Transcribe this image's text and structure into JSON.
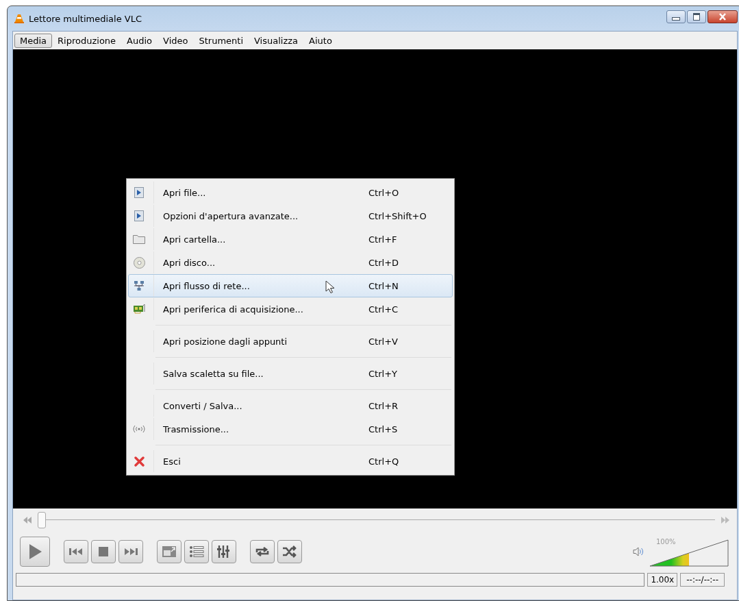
{
  "window": {
    "title": "Lettore multimediale VLC"
  },
  "menubar": [
    {
      "label": "Media",
      "selected": true
    },
    {
      "label": "Riproduzione",
      "selected": false
    },
    {
      "label": "Audio",
      "selected": false
    },
    {
      "label": "Video",
      "selected": false
    },
    {
      "label": "Strumenti",
      "selected": false
    },
    {
      "label": "Visualizza",
      "selected": false
    },
    {
      "label": "Aiuto",
      "selected": false
    }
  ],
  "menu": {
    "sections": [
      [
        {
          "kind": "file",
          "label": "Apri file...",
          "shortcut": "Ctrl+O",
          "selected": false
        },
        {
          "kind": "file",
          "label": "Opzioni d'apertura avanzate...",
          "shortcut": "Ctrl+Shift+O",
          "selected": false
        },
        {
          "kind": "folder",
          "label": "Apri cartella...",
          "shortcut": "Ctrl+F",
          "selected": false
        },
        {
          "kind": "disc",
          "label": "Apri disco...",
          "shortcut": "Ctrl+D",
          "selected": false
        },
        {
          "kind": "network",
          "label": "Apri flusso di rete...",
          "shortcut": "Ctrl+N",
          "selected": true
        },
        {
          "kind": "capture",
          "label": "Apri periferica di acquisizione...",
          "shortcut": "Ctrl+C",
          "selected": false
        }
      ],
      [
        {
          "kind": "plain",
          "label": "Apri posizione dagli appunti",
          "shortcut": "Ctrl+V",
          "selected": false
        }
      ],
      [
        {
          "kind": "plain",
          "label": "Salva scaletta su file...",
          "shortcut": "Ctrl+Y",
          "selected": false
        }
      ],
      [
        {
          "kind": "plain",
          "label": "Converti / Salva...",
          "shortcut": "Ctrl+R",
          "selected": false
        },
        {
          "kind": "broadcast",
          "label": "Trasmissione...",
          "shortcut": "Ctrl+S",
          "selected": false
        }
      ],
      [
        {
          "kind": "exit",
          "label": "Esci",
          "shortcut": "Ctrl+Q",
          "selected": false
        }
      ]
    ]
  },
  "seek": {
    "level": 0
  },
  "volume": {
    "reading": "100%",
    "level": 0.5
  },
  "status_bar": {
    "speed": "1.00x",
    "time": "--:--/--:--"
  }
}
